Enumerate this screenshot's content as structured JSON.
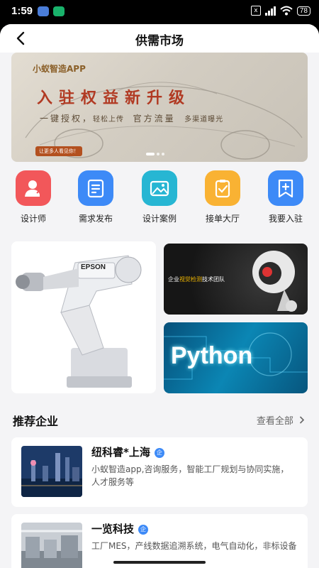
{
  "status": {
    "time": "1:59",
    "battery": "78",
    "sim_badge": "x"
  },
  "nav": {
    "title": "供需市场"
  },
  "banner": {
    "app_name": "小蚁智造APP",
    "headline": "入驻权益新升级",
    "sub_a": "一键授权，",
    "sub_b": "轻松上传",
    "sub_c": "官方流量",
    "sub_d": "多渠道曝光",
    "cta": "让更多人看见你！",
    "active_slide": 1,
    "slide_count": 3
  },
  "menu": [
    {
      "label": "设计师",
      "icon": "designer-icon",
      "color": "#f2575a"
    },
    {
      "label": "需求发布",
      "icon": "publish-icon",
      "color": "#3d8af7"
    },
    {
      "label": "设计案例",
      "icon": "case-icon",
      "color": "#27b6d3"
    },
    {
      "label": "接单大厅",
      "icon": "order-hall-icon",
      "color": "#f9b233"
    },
    {
      "label": "我要入驻",
      "icon": "join-icon",
      "color": "#3d8af7"
    }
  ],
  "promos": {
    "robot_brand": "EPSON",
    "vision_team": "视觉检测",
    "vision_pre": "企业",
    "vision_post": "技术团队",
    "python_text": "Python"
  },
  "section": {
    "title": "推荐企业",
    "see_all": "查看全部"
  },
  "companies": [
    {
      "name": "纽科睿*上海",
      "badge": "企",
      "desc": "小蚁智造app,咨询服务，智能工厂规划与协同实施，人才服务等"
    },
    {
      "name": "一览科技",
      "badge": "企",
      "desc": "工厂MES，产线数据追溯系统，电气自动化，非标设备"
    }
  ],
  "colors": {
    "accent": "#3d8af7",
    "banner_red": "#b13a23"
  }
}
